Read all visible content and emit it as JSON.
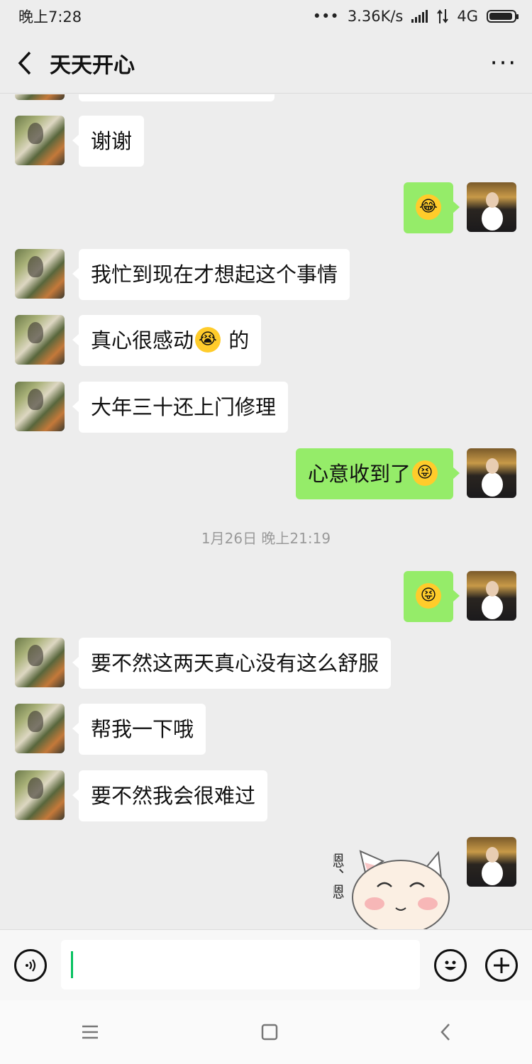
{
  "status": {
    "time": "晚上7:28",
    "dots": "•••",
    "speed": "3.36K/s",
    "network": "4G"
  },
  "header": {
    "title": "天天开心",
    "more": "···"
  },
  "messages": [
    {
      "text": "谢谢"
    },
    {
      "emoji": "😂"
    },
    {
      "text": "我忙到现在才想起这个事情"
    },
    {
      "text_before": "真心很感动",
      "emoji": "😭",
      "text_after": "的"
    },
    {
      "text": "大年三十还上门修理"
    },
    {
      "text": "心意收到了",
      "emoji": "😝"
    },
    {
      "emoji": "😝"
    },
    {
      "text": "要不然这两天真心没有这么舒服"
    },
    {
      "text": "帮我一下哦"
    },
    {
      "text": "要不然我会很难过"
    }
  ],
  "timestamp": "1月26日 晚上21:19",
  "sticker": {
    "text": "嗯、嗯"
  },
  "inputbar": {
    "voice_icon": "voice-icon",
    "emoji_icon": "smile-icon",
    "plus_icon": "plus-icon"
  },
  "navbar": {
    "menu": "≡",
    "home": "□",
    "back": "‹"
  }
}
